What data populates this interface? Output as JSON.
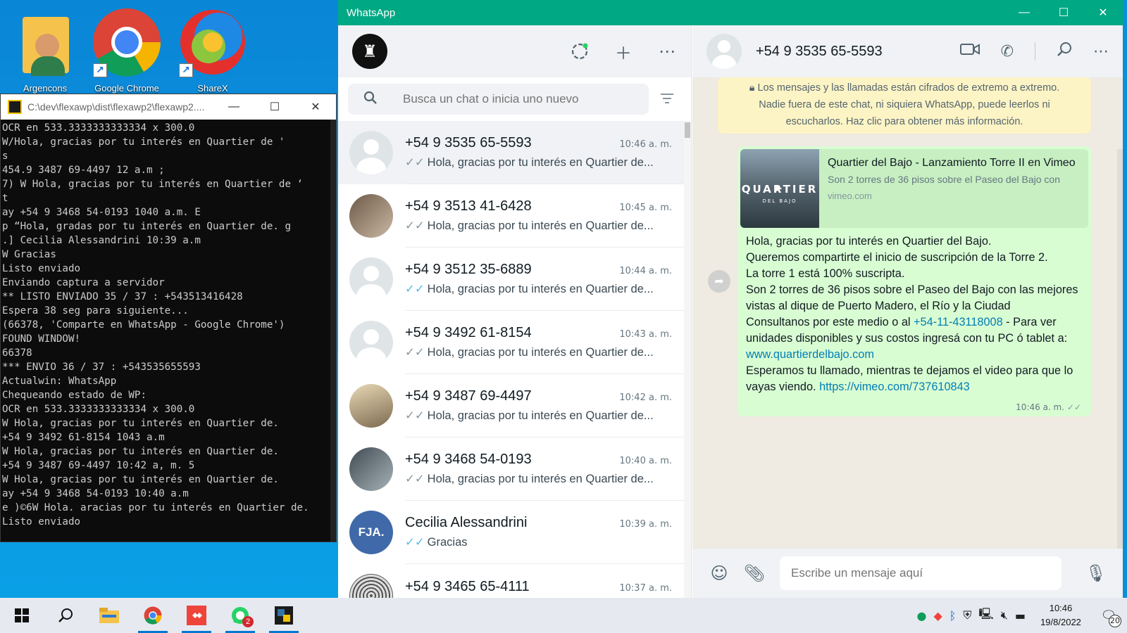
{
  "desktop": {
    "icons": [
      {
        "label": "Argencons",
        "icon": "folder-user-icon"
      },
      {
        "label": "Google Chrome",
        "icon": "chrome-icon"
      },
      {
        "label": "ShareX",
        "icon": "sharex-icon"
      }
    ]
  },
  "console": {
    "title": "C:\\dev\\flexawp\\dist\\flexawp2\\flexawp2....",
    "lines": [
      "OCR en 533.3333333333334 x 300.0",
      "W/Hola, gracias por tu interés en Quartier de '",
      "s",
      "454.9 3487 69-4497 12 a.m ;",
      "7) W Hola, gracias por tu interés en Quartier de ‘",
      "t",
      "ay +54 9 3468 54-0193 1040 a.m. E",
      "p “Hola, gradas por tu interés en Quartier de. g",
      ".] Cecilia Alessandrini 10:39 a.m",
      "W Gracias",
      "Listo enviado",
      "Enviando captura a servidor",
      "** LISTO ENVIADO 35 / 37 : +543513416428",
      "Espera 38 seg para siguiente...",
      "(66378, 'Comparte en WhatsApp - Google Chrome')",
      "FOUND WINDOW!",
      "66378",
      "*** ENVIO 36 / 37 : +543535655593",
      "Actualwin: WhatsApp",
      "Chequeando estado de WP:",
      "OCR en 533.3333333333334 x 300.0",
      "W Hola, gracias por tu interés en Quartier de.",
      "+54 9 3492 61-8154 1043 a.m",
      "W Hola, gracias por tu interés en Quartier de.",
      "+54 9 3487 69-4497 10:42 a, m. 5",
      "W Hola, gracias por tu interés en Quartier de.",
      "ay +54 9 3468 54-0193 10:40 a.m",
      "e )©6W Hola. aracias por tu interés en Quartier de.",
      "Listo enviado"
    ]
  },
  "whatsapp": {
    "window_title": "WhatsApp",
    "search_placeholder": "Busca un chat o inicia uno nuevo",
    "chats": [
      {
        "name": "+54 9 3535 65-5593",
        "time": "10:46 a. m.",
        "tick": "✓✓",
        "tick_color": "gray",
        "preview": "Hola, gracias por tu interés en Quartier de...",
        "avatar": "default"
      },
      {
        "name": "+54 9 3513 41-6428",
        "time": "10:45 a. m.",
        "tick": "✓✓",
        "tick_color": "gray",
        "preview": "Hola, gracias por tu interés en Quartier de...",
        "avatar": "photo"
      },
      {
        "name": "+54 9 3512 35-6889",
        "time": "10:44 a. m.",
        "tick": "✓✓",
        "tick_color": "blue",
        "preview": "Hola, gracias por tu interés en Quartier de...",
        "avatar": "default"
      },
      {
        "name": "+54 9 3492 61-8154",
        "time": "10:43 a. m.",
        "tick": "✓✓",
        "tick_color": "gray",
        "preview": "Hola, gracias por tu interés en Quartier de...",
        "avatar": "default"
      },
      {
        "name": "+54 9 3487 69-4497",
        "time": "10:42 a. m.",
        "tick": "✓✓",
        "tick_color": "gray",
        "preview": "Hola, gracias por tu interés en Quartier de...",
        "avatar": "photo"
      },
      {
        "name": "+54 9 3468 54-0193",
        "time": "10:40 a. m.",
        "tick": "✓✓",
        "tick_color": "gray",
        "preview": "Hola, gracias por tu interés en Quartier de...",
        "avatar": "photo"
      },
      {
        "name": "Cecilia Alessandrini",
        "time": "10:39 a. m.",
        "tick": "✓✓",
        "tick_color": "blue",
        "preview": "Gracias",
        "avatar": "fja",
        "avatar_text": "FJA."
      },
      {
        "name": "+54 9 3465 65-4111",
        "time": "10:37 a. m.",
        "tick": "",
        "tick_color": "gray",
        "preview": "",
        "avatar": "stamp"
      }
    ],
    "conversation": {
      "contact": "+54 9 3535 65-5593",
      "notice": [
        "Los mensajes y las llamadas están cifrados de extremo a extremo.",
        "Nadie fuera de este chat, ni siquiera WhatsApp, puede leerlos ni",
        "escucharlos. Haz clic para obtener más información."
      ],
      "preview": {
        "title": "Quartier del Bajo - Lanzamiento Torre II en Vimeo",
        "description": "Son 2 torres de 36 pisos sobre el Paseo del Bajo con",
        "domain": "vimeo.com",
        "thumb_text": "QUARTIER",
        "thumb_subtext": "DEL BAJO"
      },
      "message": {
        "line1": "Hola, gracias por tu interés en Quartier del Bajo.",
        "line2": "Queremos compartirte el inicio de suscripción de la Torre 2.",
        "line3": "La torre 1 está 100% suscripta.",
        "line4": "Son 2 torres de 36 pisos sobre el Paseo del Bajo con las mejores vistas al dique de Puerto Madero, el Río y la Ciudad",
        "line5_pre": "Consultanos por este medio o al ",
        "phone_link": "+54-11-43118008",
        "line5_post": " - Para ver unidades disponibles y sus costos ingresá con tu PC ó tablet a: ",
        "site_link": "www.quartierdelbajo.com",
        "line6": "Esperamos tu llamado, mientras te dejamos el video para que lo vayas viendo. ",
        "video_link": "https://vimeo.com/737610843",
        "time": "10:46 a. m.",
        "ticks": "✓✓"
      },
      "composer_placeholder": "Escribe un mensaje aquí"
    }
  },
  "taskbar": {
    "whatsapp_badge": "2",
    "clock_time": "10:46",
    "clock_date": "19/8/2022",
    "notifications": "20"
  },
  "colors": {
    "whatsapp_green": "#00a884",
    "bubble_out": "#d9fdd3",
    "link": "#027eb5",
    "blue_tick": "#53bdeb"
  }
}
